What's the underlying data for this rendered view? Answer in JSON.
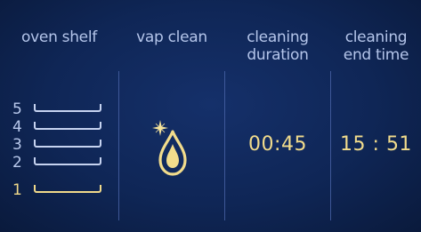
{
  "columns": {
    "oven_shelf": {
      "label": "oven shelf"
    },
    "vap_clean": {
      "label": "vap clean",
      "icon": "steam-drop-sparkle-icon"
    },
    "cleaning_duration": {
      "label_line1": "cleaning",
      "label_line2": "duration",
      "value": "00:45"
    },
    "cleaning_end_time": {
      "label_line1": "cleaning",
      "label_line2": "end time",
      "value": "15 : 51"
    }
  },
  "shelves": [
    {
      "number": "5",
      "selected": false
    },
    {
      "number": "4",
      "selected": false
    },
    {
      "number": "3",
      "selected": false
    },
    {
      "number": "2",
      "selected": false
    },
    {
      "number": "1",
      "selected": true
    }
  ],
  "colors": {
    "background": "#0f2656",
    "text": "#b9c9ec",
    "highlight": "#f2dc8c",
    "divider": "#4a64a8"
  }
}
